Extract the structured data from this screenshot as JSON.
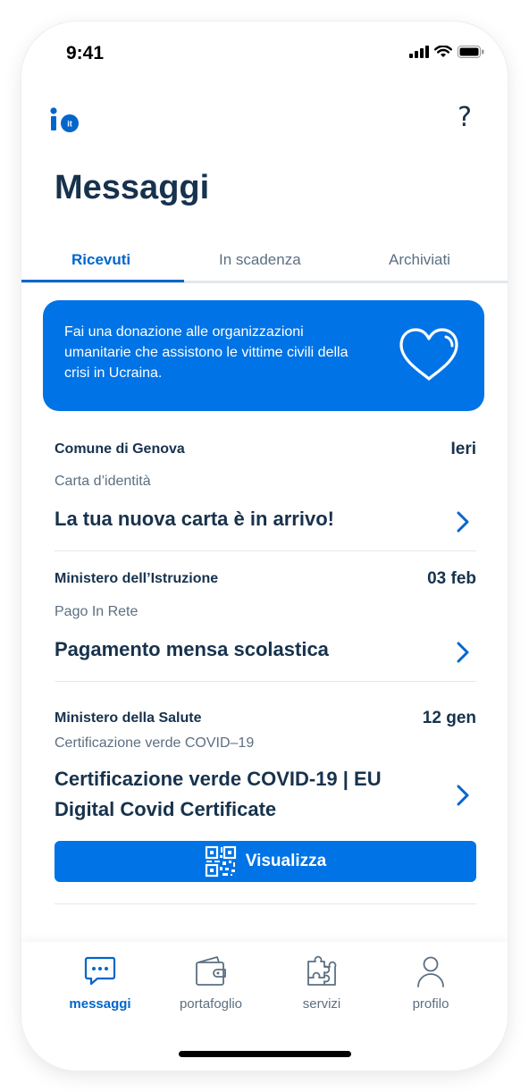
{
  "status_bar": {
    "time": "9:41"
  },
  "app": {
    "logo_text": "io",
    "logo_suffix": "it",
    "help_label": "?"
  },
  "page_title": "Messaggi",
  "tabs": [
    {
      "label": "Ricevuti",
      "active": true
    },
    {
      "label": "In scadenza",
      "active": false
    },
    {
      "label": "Archiviati",
      "active": false
    }
  ],
  "banner": {
    "text": "Fai una donazione alle organizzazioni umanitarie che assistono le vittime civili della crisi in Ucraina.",
    "icon": "heart-icon"
  },
  "messages": [
    {
      "sender": "Comune di Genova",
      "date": "Ieri",
      "service": "Carta d’identità",
      "subject": "La tua nuova carta è in arrivo!"
    },
    {
      "sender": "Ministero dell’Istruzione",
      "date": "03 feb",
      "service": "Pago In Rete",
      "subject": "Pagamento mensa scolastica"
    },
    {
      "sender": "Ministero della Salute",
      "date": "12 gen",
      "service": "Certificazione verde COVID–19",
      "subject_line1": "Certificazione verde COVID-19 | EU",
      "subject_line2": "Digital Covid Certificate",
      "action_label": "Visualizza"
    }
  ],
  "bottom_nav": [
    {
      "label": "messaggi",
      "icon": "chat-icon",
      "active": true
    },
    {
      "label": "portafoglio",
      "icon": "wallet-icon",
      "active": false
    },
    {
      "label": "servizi",
      "icon": "puzzle-icon",
      "active": false
    },
    {
      "label": "profilo",
      "icon": "user-icon",
      "active": false
    }
  ],
  "colors": {
    "primary": "#0073e6",
    "text": "#17324d",
    "secondary_text": "#5c6f82",
    "divider": "#e3e8ee"
  }
}
